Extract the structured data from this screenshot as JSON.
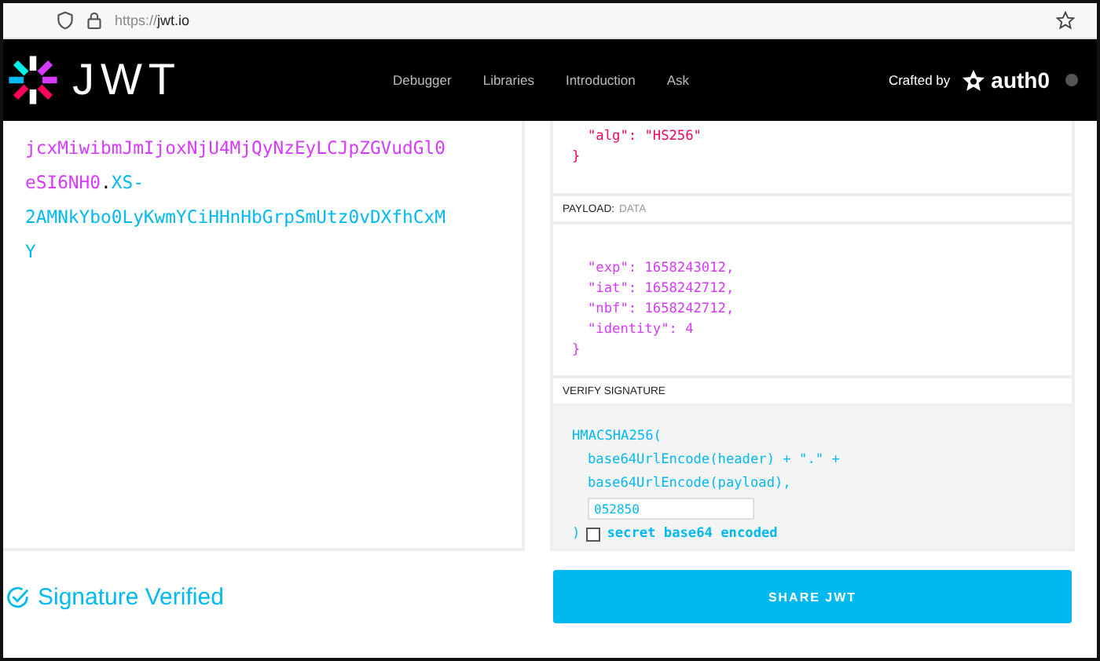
{
  "browser": {
    "url_scheme": "https://",
    "url_host": "jwt.io"
  },
  "nav": {
    "logo_text": "JWT",
    "links": [
      "Debugger",
      "Libraries",
      "Introduction",
      "Ask"
    ],
    "crafted_by": "Crafted by",
    "brand": "auth0"
  },
  "encoded": {
    "lines": [
      [
        {
          "kind": "payload",
          "text": "jcxMiwibmJmIjoxNjU4MjQyNzEyLCJpZGVudGl0"
        }
      ],
      [
        {
          "kind": "payload",
          "text": "eSI6NH0"
        },
        {
          "kind": "dot",
          "text": "."
        },
        {
          "kind": "signature",
          "text": "XS-"
        }
      ],
      [
        {
          "kind": "signature",
          "text": "2AMNkYbo0LyKwmYCiHHnHbGrpSmUtz0vDXfhCxM"
        }
      ],
      [
        {
          "kind": "signature",
          "text": "Y"
        }
      ]
    ]
  },
  "header_panel": {
    "lines": [
      {
        "kind": "entry",
        "text": "\"alg\": \"HS256\""
      },
      {
        "kind": "brace",
        "text": "}"
      }
    ]
  },
  "payload_panel": {
    "title": "PAYLOAD:",
    "subtitle": "DATA",
    "lines": [
      {
        "kind": "entry",
        "text": "\"exp\": 1658243012,"
      },
      {
        "kind": "entry",
        "text": "\"iat\": 1658242712,"
      },
      {
        "kind": "entry",
        "text": "\"nbf\": 1658242712,"
      },
      {
        "kind": "entry",
        "text": "\"identity\": 4"
      },
      {
        "kind": "brace",
        "text": "}"
      }
    ]
  },
  "verify_panel": {
    "title": "VERIFY SIGNATURE",
    "lines": [
      {
        "kind": "brace",
        "text": "HMACSHA256("
      },
      {
        "kind": "entry",
        "text": "base64UrlEncode(header) + \".\" +"
      },
      {
        "kind": "entry",
        "text": "base64UrlEncode(payload),"
      }
    ],
    "secret": "052850",
    "close": ")",
    "checkbox": {
      "label": "secret base64 encoded",
      "checked": false
    }
  },
  "status": "Signature Verified",
  "share_button": "SHARE JWT"
}
